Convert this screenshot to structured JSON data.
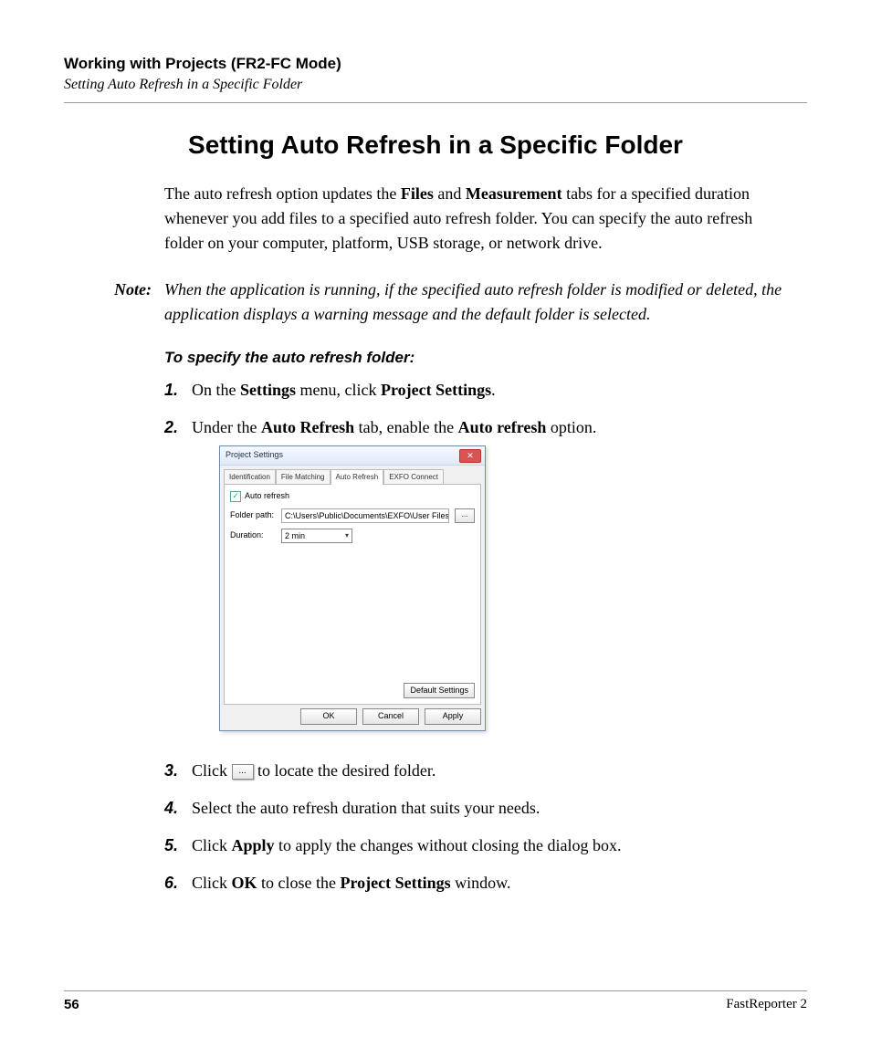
{
  "header": {
    "breadcrumb": "Working with Projects (FR2-FC Mode)",
    "subtitle": "Setting Auto Refresh in a Specific Folder"
  },
  "heading": "Setting Auto Refresh in a Specific Folder",
  "intro": {
    "pre": "The auto refresh option updates the ",
    "b1": "Files",
    "mid1": " and ",
    "b2": "Measurement",
    "post": " tabs for a specified duration whenever you add files to a specified auto refresh folder. You can specify the auto refresh folder on your computer, platform, USB storage, or network drive."
  },
  "note": {
    "label": "Note:",
    "text": "When the application is running, if the specified auto refresh folder is modified or deleted, the application displays a warning message and the default folder is selected."
  },
  "procedure_title": "To specify the auto refresh folder:",
  "steps": {
    "s1": {
      "num": "1.",
      "a": "On the ",
      "b1": "Settings",
      "b": " menu, click ",
      "b2": "Project Settings",
      "c": "."
    },
    "s2": {
      "num": "2.",
      "a": "Under the ",
      "b1": "Auto Refresh",
      "b": " tab, enable the ",
      "b2": "Auto refresh",
      "c": " option."
    },
    "s3": {
      "num": "3.",
      "a": "Click ",
      "btn": "...",
      "b": " to locate the desired folder."
    },
    "s4": {
      "num": "4.",
      "a": "Select the auto refresh duration that suits your needs."
    },
    "s5": {
      "num": "5.",
      "a": "Click ",
      "b1": "Apply",
      "b": " to apply the changes without closing the dialog box."
    },
    "s6": {
      "num": "6.",
      "a": "Click ",
      "b1": "OK",
      "b": " to close the ",
      "b2": "Project Settings",
      "c": " window."
    }
  },
  "dialog": {
    "title": "Project Settings",
    "close": "✕",
    "tabs": {
      "t1": "Identification",
      "t2": "File Matching",
      "t3": "Auto Refresh",
      "t4": "EXFO Connect"
    },
    "check_label": "Auto refresh",
    "folder_label": "Folder path:",
    "folder_value": "C:\\Users\\Public\\Documents\\EXFO\\User Files",
    "browse": "...",
    "duration_label": "Duration:",
    "duration_value": "2 min",
    "default_btn": "Default Settings",
    "ok": "OK",
    "cancel": "Cancel",
    "apply": "Apply"
  },
  "footer": {
    "page": "56",
    "product": "FastReporter 2"
  }
}
